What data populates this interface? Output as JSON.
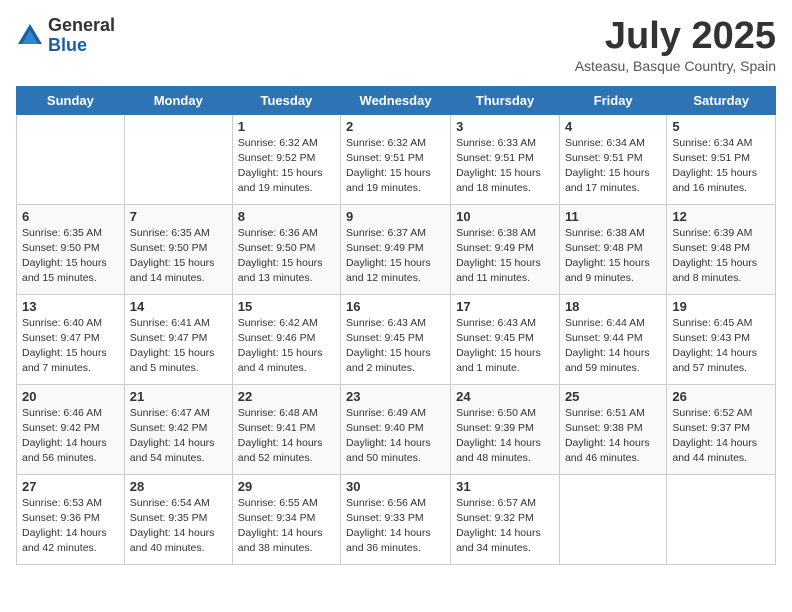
{
  "logo": {
    "general": "General",
    "blue": "Blue"
  },
  "title": "July 2025",
  "subtitle": "Asteasu, Basque Country, Spain",
  "weekdays": [
    "Sunday",
    "Monday",
    "Tuesday",
    "Wednesday",
    "Thursday",
    "Friday",
    "Saturday"
  ],
  "weeks": [
    [
      {
        "day": "",
        "info": ""
      },
      {
        "day": "",
        "info": ""
      },
      {
        "day": "1",
        "info": "Sunrise: 6:32 AM\nSunset: 9:52 PM\nDaylight: 15 hours and 19 minutes."
      },
      {
        "day": "2",
        "info": "Sunrise: 6:32 AM\nSunset: 9:51 PM\nDaylight: 15 hours and 19 minutes."
      },
      {
        "day": "3",
        "info": "Sunrise: 6:33 AM\nSunset: 9:51 PM\nDaylight: 15 hours and 18 minutes."
      },
      {
        "day": "4",
        "info": "Sunrise: 6:34 AM\nSunset: 9:51 PM\nDaylight: 15 hours and 17 minutes."
      },
      {
        "day": "5",
        "info": "Sunrise: 6:34 AM\nSunset: 9:51 PM\nDaylight: 15 hours and 16 minutes."
      }
    ],
    [
      {
        "day": "6",
        "info": "Sunrise: 6:35 AM\nSunset: 9:50 PM\nDaylight: 15 hours and 15 minutes."
      },
      {
        "day": "7",
        "info": "Sunrise: 6:35 AM\nSunset: 9:50 PM\nDaylight: 15 hours and 14 minutes."
      },
      {
        "day": "8",
        "info": "Sunrise: 6:36 AM\nSunset: 9:50 PM\nDaylight: 15 hours and 13 minutes."
      },
      {
        "day": "9",
        "info": "Sunrise: 6:37 AM\nSunset: 9:49 PM\nDaylight: 15 hours and 12 minutes."
      },
      {
        "day": "10",
        "info": "Sunrise: 6:38 AM\nSunset: 9:49 PM\nDaylight: 15 hours and 11 minutes."
      },
      {
        "day": "11",
        "info": "Sunrise: 6:38 AM\nSunset: 9:48 PM\nDaylight: 15 hours and 9 minutes."
      },
      {
        "day": "12",
        "info": "Sunrise: 6:39 AM\nSunset: 9:48 PM\nDaylight: 15 hours and 8 minutes."
      }
    ],
    [
      {
        "day": "13",
        "info": "Sunrise: 6:40 AM\nSunset: 9:47 PM\nDaylight: 15 hours and 7 minutes."
      },
      {
        "day": "14",
        "info": "Sunrise: 6:41 AM\nSunset: 9:47 PM\nDaylight: 15 hours and 5 minutes."
      },
      {
        "day": "15",
        "info": "Sunrise: 6:42 AM\nSunset: 9:46 PM\nDaylight: 15 hours and 4 minutes."
      },
      {
        "day": "16",
        "info": "Sunrise: 6:43 AM\nSunset: 9:45 PM\nDaylight: 15 hours and 2 minutes."
      },
      {
        "day": "17",
        "info": "Sunrise: 6:43 AM\nSunset: 9:45 PM\nDaylight: 15 hours and 1 minute."
      },
      {
        "day": "18",
        "info": "Sunrise: 6:44 AM\nSunset: 9:44 PM\nDaylight: 14 hours and 59 minutes."
      },
      {
        "day": "19",
        "info": "Sunrise: 6:45 AM\nSunset: 9:43 PM\nDaylight: 14 hours and 57 minutes."
      }
    ],
    [
      {
        "day": "20",
        "info": "Sunrise: 6:46 AM\nSunset: 9:42 PM\nDaylight: 14 hours and 56 minutes."
      },
      {
        "day": "21",
        "info": "Sunrise: 6:47 AM\nSunset: 9:42 PM\nDaylight: 14 hours and 54 minutes."
      },
      {
        "day": "22",
        "info": "Sunrise: 6:48 AM\nSunset: 9:41 PM\nDaylight: 14 hours and 52 minutes."
      },
      {
        "day": "23",
        "info": "Sunrise: 6:49 AM\nSunset: 9:40 PM\nDaylight: 14 hours and 50 minutes."
      },
      {
        "day": "24",
        "info": "Sunrise: 6:50 AM\nSunset: 9:39 PM\nDaylight: 14 hours and 48 minutes."
      },
      {
        "day": "25",
        "info": "Sunrise: 6:51 AM\nSunset: 9:38 PM\nDaylight: 14 hours and 46 minutes."
      },
      {
        "day": "26",
        "info": "Sunrise: 6:52 AM\nSunset: 9:37 PM\nDaylight: 14 hours and 44 minutes."
      }
    ],
    [
      {
        "day": "27",
        "info": "Sunrise: 6:53 AM\nSunset: 9:36 PM\nDaylight: 14 hours and 42 minutes."
      },
      {
        "day": "28",
        "info": "Sunrise: 6:54 AM\nSunset: 9:35 PM\nDaylight: 14 hours and 40 minutes."
      },
      {
        "day": "29",
        "info": "Sunrise: 6:55 AM\nSunset: 9:34 PM\nDaylight: 14 hours and 38 minutes."
      },
      {
        "day": "30",
        "info": "Sunrise: 6:56 AM\nSunset: 9:33 PM\nDaylight: 14 hours and 36 minutes."
      },
      {
        "day": "31",
        "info": "Sunrise: 6:57 AM\nSunset: 9:32 PM\nDaylight: 14 hours and 34 minutes."
      },
      {
        "day": "",
        "info": ""
      },
      {
        "day": "",
        "info": ""
      }
    ]
  ]
}
